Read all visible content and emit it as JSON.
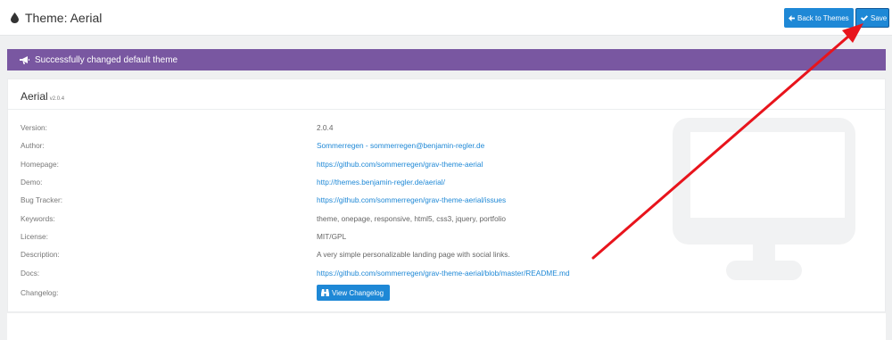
{
  "header": {
    "title": "Theme: Aerial",
    "back_label": "Back to Themes",
    "save_label": "Save"
  },
  "alert": {
    "message": "Successfully changed default theme"
  },
  "theme": {
    "name": "Aerial",
    "version_badge": "v2.0.4"
  },
  "details": {
    "labels": {
      "version": "Version:",
      "author": "Author:",
      "homepage": "Homepage:",
      "demo": "Demo:",
      "bugs": "Bug Tracker:",
      "keywords": "Keywords:",
      "license": "License:",
      "description": "Description:",
      "docs": "Docs:",
      "changelog": "Changelog:"
    },
    "values": {
      "version": "2.0.4",
      "author": "Sommerregen - sommerregen@benjamin-regler.de",
      "homepage": "https://github.com/sommerregen/grav-theme-aerial",
      "demo": "http://themes.benjamin-regler.de/aerial/",
      "bugs": "https://github.com/sommerregen/grav-theme-aerial/issues",
      "keywords": "theme, onepage, responsive, html5, css3, jquery, portfolio",
      "license": "MIT/GPL",
      "description": "A very simple personalizable landing page with social links.",
      "docs": "https://github.com/sommerregen/grav-theme-aerial/blob/master/README.md"
    },
    "changelog_button": "View Changelog"
  },
  "colors": {
    "accent": "#1e88d6",
    "alert_bg": "#7957a1",
    "annotation_arrow": "#e8141c"
  },
  "icons": {
    "title": "drop-icon",
    "back": "arrow-left-icon",
    "save": "check-icon",
    "alert": "bullhorn-icon",
    "changelog": "binoculars-icon",
    "preview": "monitor-icon"
  }
}
